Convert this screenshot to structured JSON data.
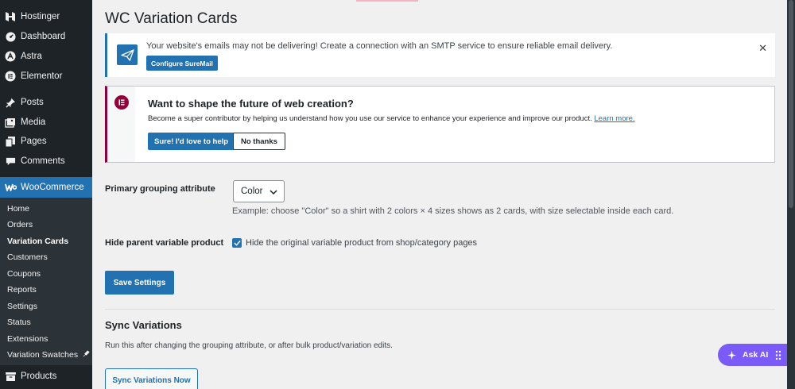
{
  "sidebar": {
    "top_items": [
      {
        "label": "Hostinger",
        "icon": "hostinger-icon"
      },
      {
        "label": "Dashboard",
        "icon": "dashboard-icon"
      },
      {
        "label": "Astra",
        "icon": "astra-icon"
      },
      {
        "label": "Elementor",
        "icon": "elementor-icon"
      },
      {
        "label": "Posts",
        "icon": "pin-icon"
      },
      {
        "label": "Media",
        "icon": "media-icon"
      },
      {
        "label": "Pages",
        "icon": "pages-icon"
      },
      {
        "label": "Comments",
        "icon": "comments-icon"
      }
    ],
    "woocommerce": {
      "label": "WooCommerce",
      "icon": "woocommerce-icon"
    },
    "submenu": [
      "Home",
      "Orders",
      "Variation Cards",
      "Customers",
      "Coupons",
      "Reports",
      "Settings",
      "Status",
      "Extensions",
      "Variation Swatches"
    ],
    "current_submenu": "Variation Cards",
    "products": {
      "label": "Products",
      "icon": "products-icon"
    }
  },
  "page": {
    "title": "WC Variation Cards"
  },
  "smtp_notice": {
    "text": "Your website's emails may not be delivering! Create a connection with an SMTP service to ensure reliable email delivery.",
    "button": "Configure SureMail",
    "icon": "paper-plane-icon"
  },
  "elementor_notice": {
    "title": "Want to shape the future of web creation?",
    "description": "Become a super contributor by helping us understand how you use our service to enhance your experience and improve our product.",
    "link": "Learn more.",
    "primary_button": "Sure! I'd love to help",
    "secondary_button": "No thanks"
  },
  "form": {
    "grouping_label": "Primary grouping attribute",
    "grouping_value": "Color",
    "grouping_help": "Example: choose \"Color\" so a shirt with 2 colors × 4 sizes shows as 2 cards, with size selectable inside each card.",
    "hide_parent_label": "Hide parent variable product",
    "hide_parent_checkbox": "Hide the original variable product from shop/category pages",
    "hide_parent_checked": true,
    "save_button": "Save Settings"
  },
  "sync": {
    "title": "Sync Variations",
    "description": "Run this after changing the grouping attribute, or after bulk product/variation edits.",
    "button": "Sync Variations Now"
  },
  "ask_ai": {
    "label": "Ask AI"
  },
  "colors": {
    "sidebar": "#1d2327",
    "accent": "#2271b1",
    "elementor": "#92003b",
    "ask_ai": "#7a5af8"
  }
}
